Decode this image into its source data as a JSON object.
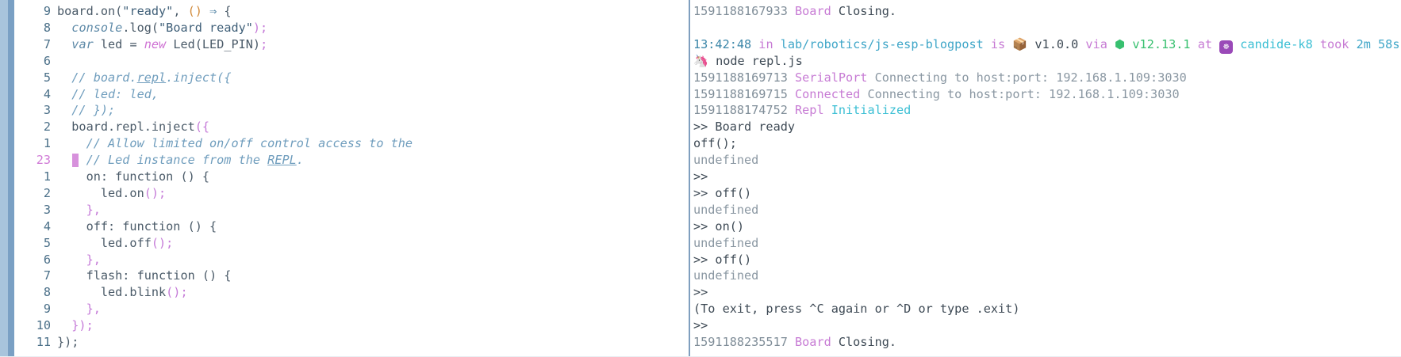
{
  "editor": {
    "lines": [
      {
        "num": "9",
        "segments": [
          [
            "plain",
            "board.on("
          ],
          [
            "str",
            "\"ready\""
          ],
          [
            "plain",
            ", "
          ],
          [
            "paren-o",
            "()"
          ],
          [
            "plain",
            " "
          ],
          [
            "arrow",
            "⇒"
          ],
          [
            "plain",
            " {"
          ]
        ]
      },
      {
        "num": "8",
        "segments": [
          [
            "plain",
            "  "
          ],
          [
            "kw-it",
            "console"
          ],
          [
            "plain",
            ".log("
          ],
          [
            "str",
            "\"Board ready\""
          ],
          [
            "pun",
            ");"
          ]
        ]
      },
      {
        "num": "7",
        "segments": [
          [
            "plain",
            "  "
          ],
          [
            "kw-it",
            "var"
          ],
          [
            "plain",
            " led = "
          ],
          [
            "new",
            "new"
          ],
          [
            "plain",
            " Led(LED_PIN)"
          ],
          [
            "pun",
            ";"
          ]
        ]
      },
      {
        "num": "6",
        "segments": [
          [
            "plain",
            ""
          ]
        ]
      },
      {
        "num": "5",
        "segments": [
          [
            "com",
            "  // board."
          ],
          [
            "com u",
            "repl"
          ],
          [
            "com",
            ".inject({"
          ]
        ]
      },
      {
        "num": "4",
        "segments": [
          [
            "com",
            "  // led: led,"
          ]
        ]
      },
      {
        "num": "3",
        "segments": [
          [
            "com",
            "  // });"
          ]
        ]
      },
      {
        "num": "2",
        "segments": [
          [
            "plain",
            "  board.repl.inject"
          ],
          [
            "pun",
            "({"
          ]
        ]
      },
      {
        "num": "1",
        "segments": [
          [
            "com",
            "    // Allow limited on/off control access to the"
          ]
        ]
      },
      {
        "num": "23",
        "current": true,
        "segments": [
          [
            "com",
            "    // Led instance from the "
          ],
          [
            "com u",
            "REPL"
          ],
          [
            "com",
            "."
          ]
        ]
      },
      {
        "num": "1",
        "segments": [
          [
            "plain",
            "    on: function () {"
          ]
        ]
      },
      {
        "num": "2",
        "segments": [
          [
            "plain",
            "      led.on"
          ],
          [
            "pun",
            "();"
          ]
        ]
      },
      {
        "num": "3",
        "segments": [
          [
            "pun",
            "    },"
          ]
        ]
      },
      {
        "num": "4",
        "segments": [
          [
            "plain",
            "    off: function () {"
          ]
        ]
      },
      {
        "num": "5",
        "segments": [
          [
            "plain",
            "      led.off"
          ],
          [
            "pun",
            "();"
          ]
        ]
      },
      {
        "num": "6",
        "segments": [
          [
            "pun",
            "    },"
          ]
        ]
      },
      {
        "num": "7",
        "segments": [
          [
            "plain",
            "    flash: function () {"
          ]
        ]
      },
      {
        "num": "8",
        "segments": [
          [
            "plain",
            "      led.blink"
          ],
          [
            "pun",
            "();"
          ]
        ]
      },
      {
        "num": "9",
        "segments": [
          [
            "pun",
            "    },"
          ]
        ]
      },
      {
        "num": "10",
        "segments": [
          [
            "pun",
            "  });"
          ]
        ]
      },
      {
        "num": "11",
        "segments": [
          [
            "plain",
            "});"
          ]
        ]
      }
    ]
  },
  "terminal": {
    "lines": [
      [
        [
          "ts",
          "1591188167933 "
        ],
        [
          "mag",
          "Board"
        ],
        [
          "dark",
          " Closing."
        ]
      ],
      [
        [
          "plain",
          ""
        ]
      ],
      [
        [
          "time",
          "13:42:48"
        ],
        [
          "mag",
          " in "
        ],
        [
          "teal",
          "lab/robotics/js-esp-blogpost"
        ],
        [
          "mag",
          " is "
        ],
        [
          "icon-box",
          "📦"
        ],
        [
          "dark",
          " v1.0.0"
        ],
        [
          "mag",
          " via "
        ],
        [
          "icon-hex",
          "⬢"
        ],
        [
          "green",
          " v12.13.1"
        ],
        [
          "mag",
          " at "
        ],
        [
          "icon-k8s",
          "☸"
        ],
        [
          "cyan",
          " candide-k8"
        ],
        [
          "mag",
          " took "
        ],
        [
          "teal",
          "2m 58s"
        ]
      ],
      [
        [
          "icon-unicorn",
          "🦄"
        ],
        [
          "dark",
          " node repl.js"
        ]
      ],
      [
        [
          "ts",
          "1591188169713 "
        ],
        [
          "mag",
          "SerialPort"
        ],
        [
          "dim",
          " Connecting to host:port: 192.168.1.109:3030"
        ]
      ],
      [
        [
          "ts",
          "1591188169715 "
        ],
        [
          "mag",
          "Connected"
        ],
        [
          "dim",
          " Connecting to host:port: 192.168.1.109:3030"
        ]
      ],
      [
        [
          "ts",
          "1591188174752 "
        ],
        [
          "mag",
          "Repl"
        ],
        [
          "cyan",
          " Initialized"
        ]
      ],
      [
        [
          "dark",
          ">> Board ready"
        ]
      ],
      [
        [
          "dark",
          "off();"
        ]
      ],
      [
        [
          "dim",
          "undefined"
        ]
      ],
      [
        [
          "dark",
          ">>"
        ]
      ],
      [
        [
          "dark",
          ">> off()"
        ]
      ],
      [
        [
          "dim",
          "undefined"
        ]
      ],
      [
        [
          "dark",
          ">> on()"
        ]
      ],
      [
        [
          "dim",
          "undefined"
        ]
      ],
      [
        [
          "dark",
          ">> off()"
        ]
      ],
      [
        [
          "dim",
          "undefined"
        ]
      ],
      [
        [
          "dark",
          ">>"
        ]
      ],
      [
        [
          "dark",
          "(To exit, press ^C again or ^D or type .exit)"
        ]
      ],
      [
        [
          "dark",
          ">>"
        ]
      ],
      [
        [
          "ts",
          "1591188235517 "
        ],
        [
          "mag",
          "Board"
        ],
        [
          "dark",
          " Closing."
        ]
      ]
    ]
  },
  "colors": {
    "background": "#ffffff",
    "accent_magenta": "#c77bd4",
    "accent_cyan": "#3bbfd4",
    "cursor": "#d791dc",
    "divider": "#7f9fbf"
  },
  "icons": {
    "package": "package-icon",
    "node": "node-hexagon-icon",
    "kubernetes": "kubernetes-icon",
    "unicorn": "unicorn-icon"
  }
}
